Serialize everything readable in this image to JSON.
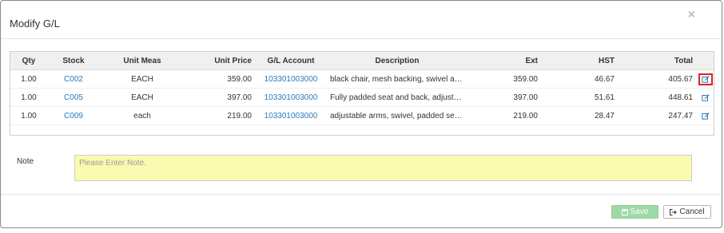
{
  "modal": {
    "title": "Modify G/L",
    "close_symbol": "×"
  },
  "table": {
    "headers": {
      "qty": "Qty",
      "stock": "Stock",
      "unit_meas": "Unit Meas",
      "unit_price": "Unit Price",
      "gl_account": "G/L Account",
      "description": "Description",
      "ext": "Ext",
      "hst": "HST",
      "total": "Total"
    },
    "rows": [
      {
        "qty": "1.00",
        "stock": "C002",
        "unit_meas": "EACH",
        "unit_price": "359.00",
        "gl_account": "103301003000",
        "description": "black chair, mesh backing, swivel and ...",
        "ext": "359.00",
        "hst": "46.67",
        "total": "405.67",
        "edit_icon": "edit-icon",
        "highlighted": true
      },
      {
        "qty": "1.00",
        "stock": "C005",
        "unit_meas": "EACH",
        "unit_price": "397.00",
        "gl_account": "103301003000",
        "description": "Fully padded seat and back, adjustabl...",
        "ext": "397.00",
        "hst": "51.61",
        "total": "448.61",
        "edit_icon": "edit-icon",
        "highlighted": false
      },
      {
        "qty": "1.00",
        "stock": "C009",
        "unit_meas": "each",
        "unit_price": "219.00",
        "gl_account": "103301003000",
        "description": "adjustable arms, swivel, padded seat ...",
        "ext": "219.00",
        "hst": "28.47",
        "total": "247.47",
        "edit_icon": "edit-icon",
        "highlighted": false
      }
    ]
  },
  "note": {
    "label": "Note",
    "placeholder": "Please Enter Note.",
    "value": ""
  },
  "footer": {
    "save_label": "Save",
    "save_icon": "floppy-disk-icon",
    "cancel_label": "Cancel",
    "cancel_icon": "sign-out-icon"
  },
  "colors": {
    "link": "#2a7ab8",
    "note_background": "#fafab0",
    "save_button": "#9fd9a5",
    "highlight_border": "#e02020",
    "header_background": "#f0f0f0"
  }
}
